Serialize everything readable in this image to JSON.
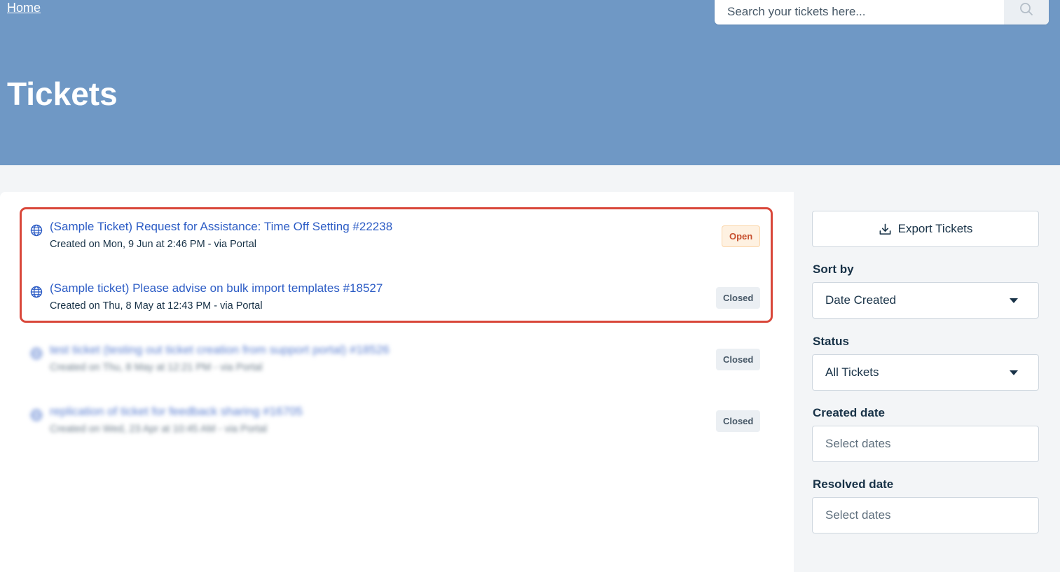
{
  "header": {
    "home_link": "Home",
    "search_placeholder": "Search your tickets here...",
    "page_title": "Tickets",
    "background_color": "#6f98c5"
  },
  "tickets": [
    {
      "title": "(Sample Ticket) Request for Assistance: Time Off Setting #22238",
      "meta": "Created on Mon, 9 Jun at 2:46 PM - via Portal",
      "status": "Open",
      "icon": "globe-icon",
      "blurred": false
    },
    {
      "title": "(Sample ticket) Please advise on bulk import templates #18527",
      "meta": "Created on Thu, 8 May at 12:43 PM - via Portal",
      "status": "Closed",
      "icon": "globe-icon",
      "blurred": false
    },
    {
      "title": "test ticket (testing out ticket creation from support portal) #18526",
      "meta": "Created on Thu, 8 May at 12:21 PM - via Portal",
      "status": "Closed",
      "icon": "globe-icon",
      "blurred": true
    },
    {
      "title": "replication of ticket for feedback sharing #16705",
      "meta": "Created on Wed, 23 Apr at 10:45 AM - via Portal",
      "status": "Closed",
      "icon": "globe-icon",
      "blurred": true
    }
  ],
  "sidebar": {
    "export_label": "Export Tickets",
    "sort_by_label": "Sort by",
    "sort_by_value": "Date Created",
    "status_label": "Status",
    "status_value": "All Tickets",
    "created_date_label": "Created date",
    "created_date_placeholder": "Select dates",
    "resolved_date_label": "Resolved date",
    "resolved_date_placeholder": "Select dates"
  },
  "colors": {
    "link": "#2c5cc5",
    "highlight_border": "#d9473a",
    "open_badge_bg": "#fef1e1",
    "open_badge_text": "#c7502f",
    "closed_badge_bg": "#ebeff3"
  }
}
